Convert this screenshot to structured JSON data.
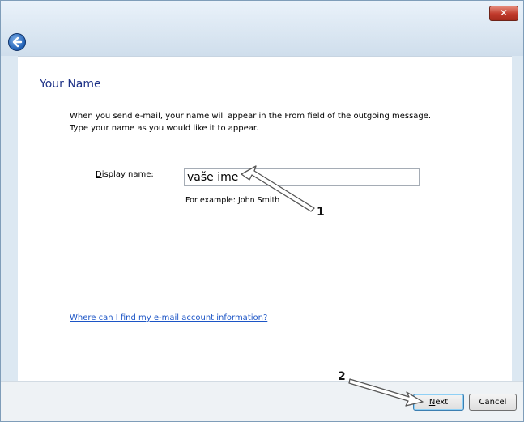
{
  "window": {
    "close_icon": "close-icon",
    "back_icon": "back-arrow-icon"
  },
  "page": {
    "heading": "Your Name",
    "intro_line1": "When you send e-mail, your name will appear in the From field of the outgoing message.",
    "intro_line2": "Type your name as you would like it to appear.",
    "display_name_label_accel": "D",
    "display_name_label_rest": "isplay name:",
    "display_name_value": "vaše ime",
    "example": "For example: John Smith",
    "help_link": "Where can I find my e-mail account information?"
  },
  "footer": {
    "next_accel": "N",
    "next_rest": "ext",
    "cancel": "Cancel"
  },
  "annotations": {
    "marker1": "1",
    "marker2": "2",
    "arrow_icon": "pointer-arrow-icon"
  }
}
